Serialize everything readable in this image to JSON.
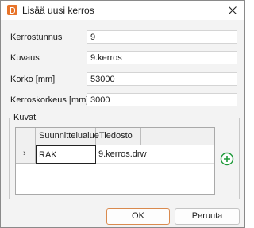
{
  "window": {
    "title": "Lisää uusi kerros",
    "icon": "app-logo-icon",
    "close_icon": "close-icon",
    "accent_color": "#e8742a"
  },
  "form": {
    "kerrostunnus": {
      "label": "Kerrostunnus",
      "value": "9"
    },
    "kuvaus": {
      "label": "Kuvaus",
      "value": "9.kerros"
    },
    "korko": {
      "label": "Korko [mm]",
      "value": "53000"
    },
    "kerroskorkeus": {
      "label": "Kerroskorkeus [mm]",
      "value": "3000"
    }
  },
  "kuvat": {
    "legend": "Kuvat",
    "columns": [
      "Suunnittelualue",
      "Tiedosto"
    ],
    "rows": [
      {
        "marker": "›",
        "suunnittelualue": "RAK",
        "tiedosto": "9.kerros.drw"
      }
    ],
    "add_icon": "add-circle-icon",
    "add_color": "#1f9a3a"
  },
  "buttons": {
    "ok": "OK",
    "cancel": "Peruuta"
  }
}
